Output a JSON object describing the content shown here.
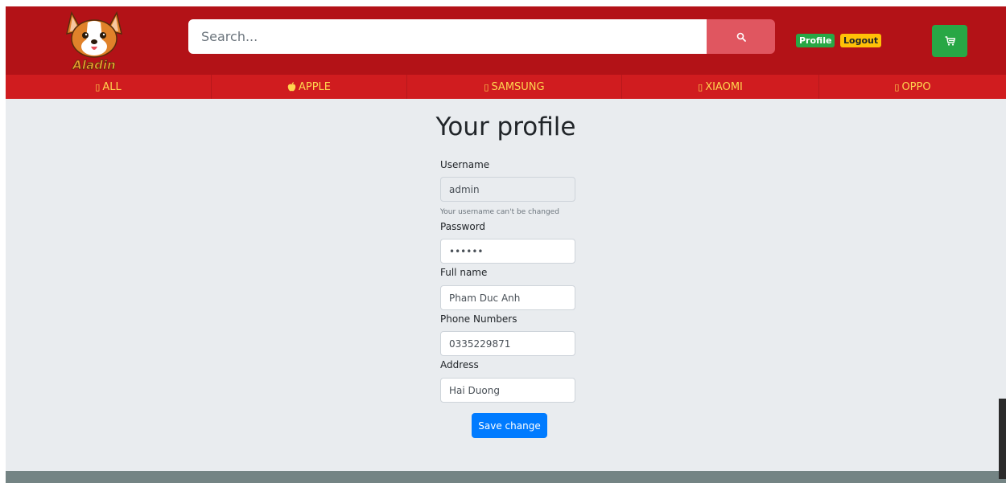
{
  "header": {
    "logo_text": "Aladin",
    "search": {
      "placeholder": "Search...",
      "value": ""
    },
    "profile_label": "Profile",
    "logout_label": "Logout"
  },
  "categories": [
    {
      "label": "ALL",
      "icon": "phone-icon"
    },
    {
      "label": "APPLE",
      "icon": "apple-icon"
    },
    {
      "label": "SAMSUNG",
      "icon": "phone-icon"
    },
    {
      "label": "XIAOMI",
      "icon": "phone-icon"
    },
    {
      "label": "OPPO",
      "icon": "phone-icon"
    }
  ],
  "profile": {
    "title": "Your profile",
    "username_label": "Username",
    "username_value": "admin",
    "username_hint": "Your username can't be changed",
    "password_label": "Password",
    "password_value": "123456",
    "fullname_label": "Full name",
    "fullname_value": "Pham Duc Anh",
    "phone_label": "Phone Numbers",
    "phone_value": "0335229871",
    "address_label": "Address",
    "address_value": "Hai Duong",
    "save_label": "Save change"
  },
  "colors": {
    "header_bg": "#b31217",
    "nav_bg": "#d01c1f",
    "nav_text": "#ffd54f",
    "search_button": "#e05660",
    "profile_badge": "#28a745",
    "logout_badge": "#ffc107",
    "cart_button": "#28a745",
    "save_button": "#007bff",
    "page_bg": "#e9ecef"
  }
}
